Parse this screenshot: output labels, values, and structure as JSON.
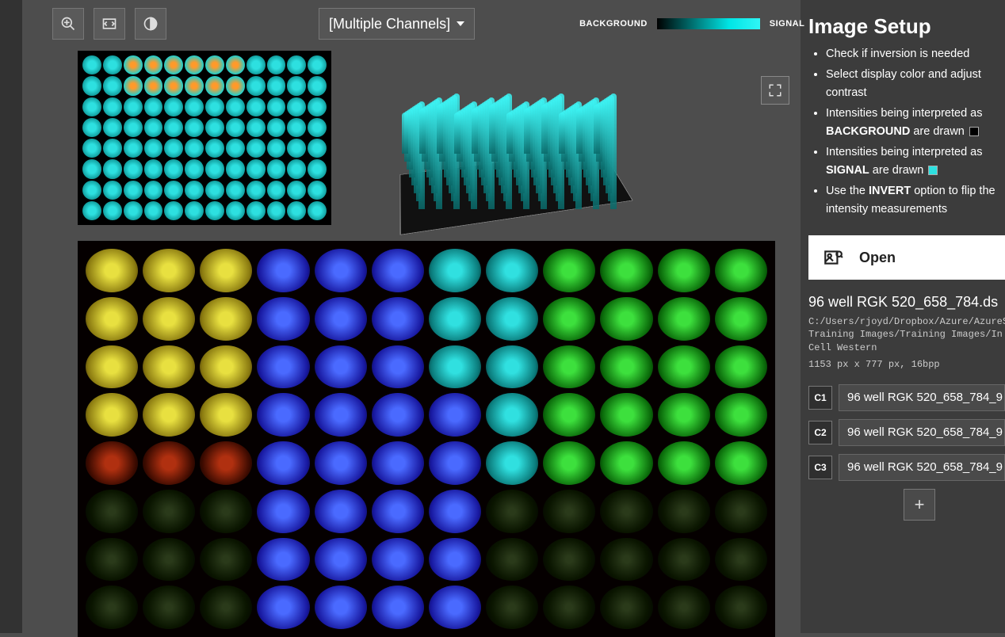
{
  "toolbar": {
    "zoom_tooltip": "Zoom",
    "fit_tooltip": "Fit",
    "contrast_tooltip": "Contrast",
    "channel_label": "[Multiple Channels]"
  },
  "legend": {
    "background_label": "BACKGROUND",
    "signal_label": "SIGNAL"
  },
  "sidebar": {
    "title": "Image Setup",
    "bullets": {
      "b1": "Check if inversion is needed",
      "b2": "Select display color and adjust contrast",
      "b3a": "Intensities being interpreted as ",
      "b3b": "BACKGROUND",
      "b3c": " are drawn ",
      "b4a": "Intensities being interpreted as ",
      "b4b": "SIGNAL",
      "b4c": " are drawn ",
      "b5a": "Use the ",
      "b5b": "INVERT",
      "b5c": " option to flip the intensity measurements"
    },
    "open_label": "Open",
    "file": {
      "name": "96 well RGK 520_658_784.ds",
      "path": "C:/Users/rjoyd/Dropbox/Azure/AzureSpot Training Images/Training Images/In Cell Western",
      "dims": "1153 px x 777 px, 16bpp"
    },
    "channels": [
      {
        "tag": "C1",
        "name": "96 well RGK 520_658_784_9"
      },
      {
        "tag": "C2",
        "name": "96 well RGK 520_658_784_9"
      },
      {
        "tag": "C3",
        "name": "96 well RGK 520_658_784_9"
      }
    ],
    "add_label": "+"
  }
}
